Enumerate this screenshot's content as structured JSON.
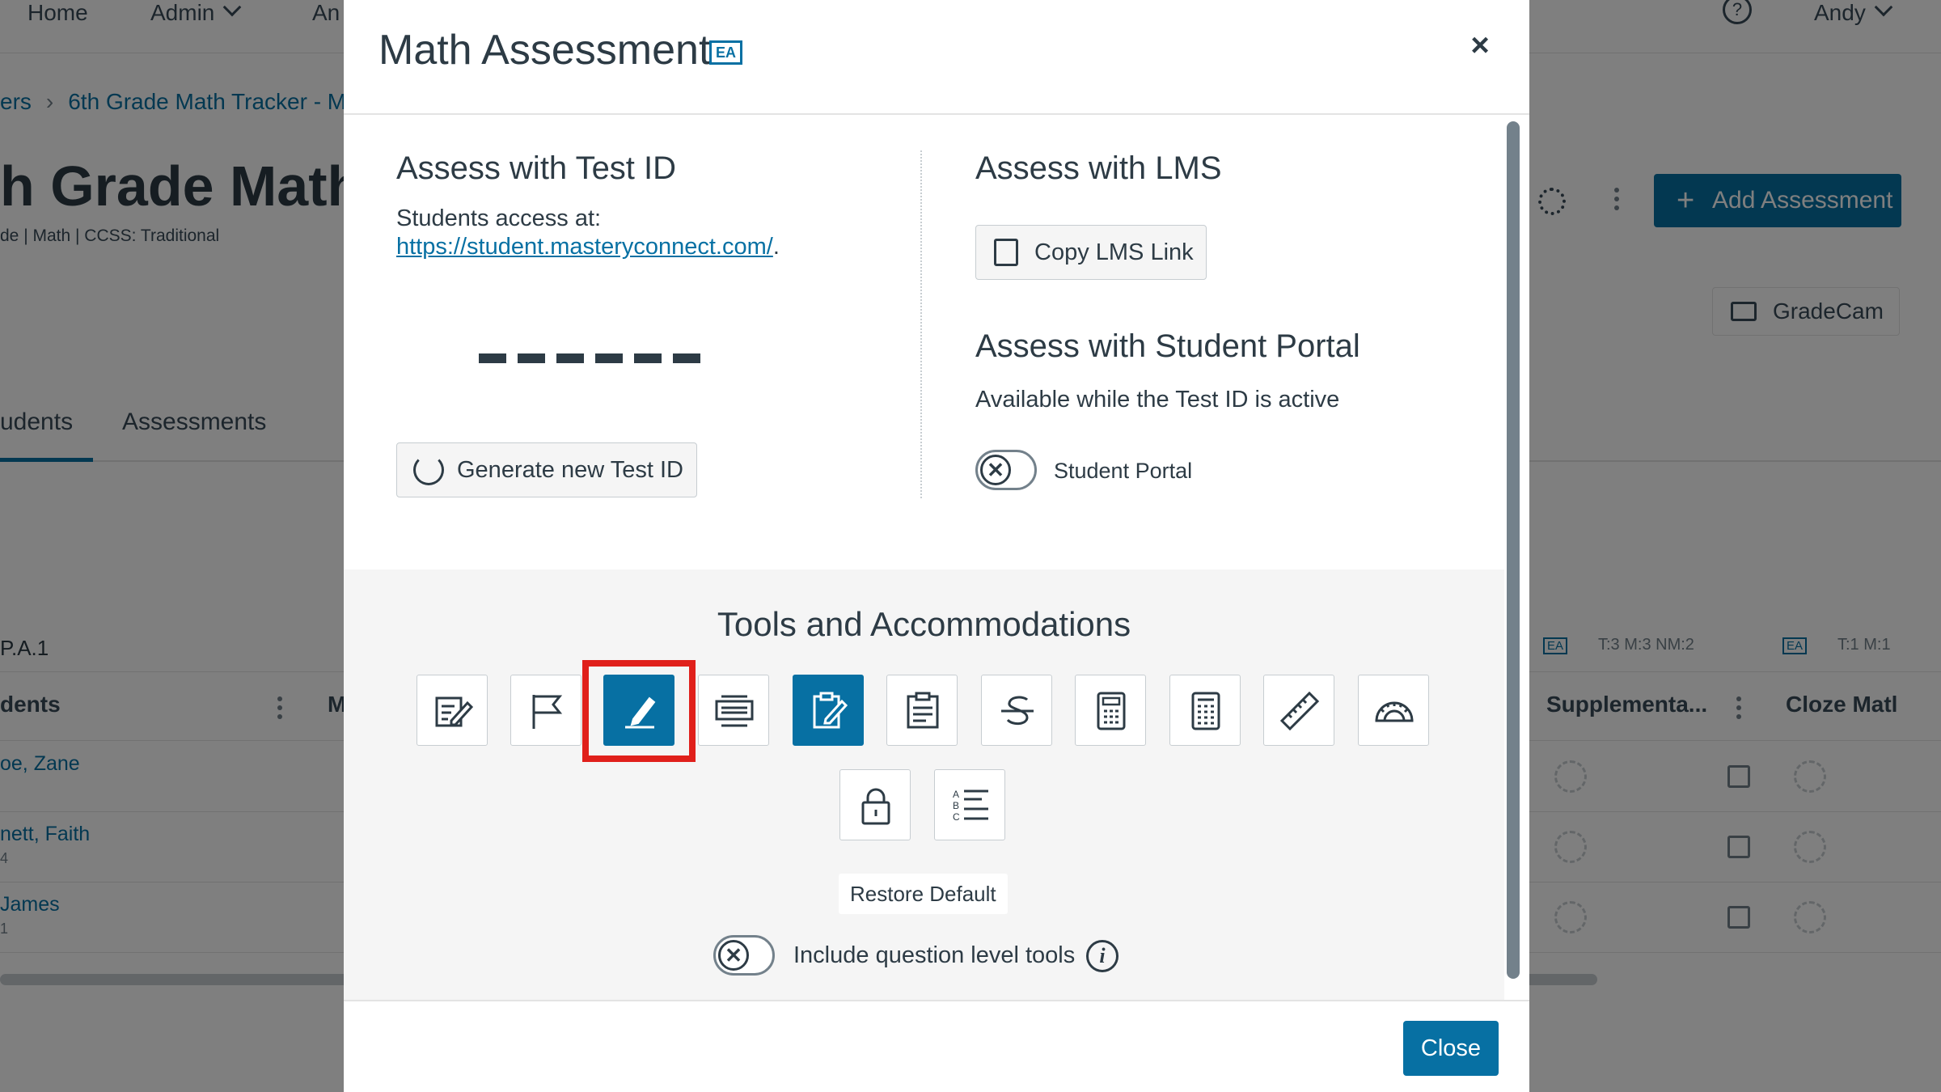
{
  "background": {
    "nav": {
      "home": "Home",
      "admin": "Admin",
      "third": "An",
      "user": "Andy"
    },
    "breadcrumb": {
      "parent": "ers",
      "current": "6th Grade Math Tracker - M"
    },
    "page_title": "h Grade Math",
    "page_meta": "de | Math | CCSS: Traditional",
    "add_assessment": "Add Assessment",
    "gradecam": "GradeCam",
    "tabs": {
      "students": "udents",
      "assessments": "Assessments"
    },
    "standard_code": "P.A.1",
    "columns": {
      "students": "dents",
      "col2": "M",
      "supplemental": "Supplementa...",
      "cloze": "Cloze Matl"
    },
    "column_meta": {
      "left": "T:3 M:3 NM:2",
      "right": "T:1 M:1",
      "ea": "EA"
    },
    "rows": [
      {
        "name": "oe, Zane",
        "sub": ""
      },
      {
        "name": "nett, Faith",
        "sub": "4"
      },
      {
        "name": "James",
        "sub": "1"
      }
    ]
  },
  "modal": {
    "title": "Math Assessment",
    "badge": "EA",
    "close_icon": "×",
    "test_id": {
      "heading": "Assess with Test ID",
      "access_label": "Students access at:",
      "url": "https://student.masteryconnect.com/",
      "url_suffix": ".",
      "generate_label": "Generate new Test ID"
    },
    "lms": {
      "heading": "Assess with LMS",
      "copy_label": "Copy LMS Link"
    },
    "portal": {
      "heading": "Assess with Student Portal",
      "description": "Available while the Test ID is active",
      "toggle_label": "Student Portal",
      "toggle_on": false,
      "toggle_glyph": "✕"
    },
    "tools": {
      "heading": "Tools and Accommodations",
      "items": [
        {
          "icon": "notepad-icon",
          "active": false
        },
        {
          "icon": "flag-icon",
          "active": false
        },
        {
          "icon": "highlighter-icon",
          "active": true,
          "highlighted": true
        },
        {
          "icon": "line-reader-icon",
          "active": false
        },
        {
          "icon": "answer-edit-icon",
          "active": true
        },
        {
          "icon": "clipboard-icon",
          "active": false
        },
        {
          "icon": "strikethrough-icon",
          "active": false
        },
        {
          "icon": "basic-calculator-icon",
          "active": false
        },
        {
          "icon": "scientific-calculator-icon",
          "active": false
        },
        {
          "icon": "ruler-icon",
          "active": false
        },
        {
          "icon": "protractor-icon",
          "active": false
        },
        {
          "icon": "lock-icon",
          "active": false
        },
        {
          "icon": "answer-choices-icon",
          "active": false
        }
      ],
      "restore_label": "Restore Default",
      "question_level_label": "Include question level tools",
      "question_level_on": false,
      "info_glyph": "i"
    },
    "close_button": "Close"
  },
  "colors": {
    "accent": "#0770a3",
    "highlight": "#e0201b",
    "panel": "#f5f5f5",
    "text": "#2d3b45"
  }
}
